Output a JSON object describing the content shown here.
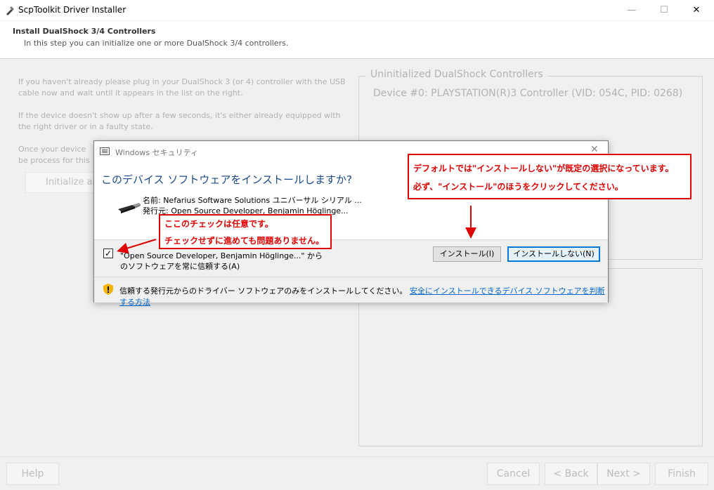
{
  "window": {
    "title": "ScpToolkit Driver Installer",
    "min_glyph": "—",
    "max_glyph": "☐",
    "close_glyph": "✕"
  },
  "header": {
    "title": "Install DualShock 3/4 Controllers",
    "description": "In this step you can initialize one or more DualShock 3/4 controllers."
  },
  "instructions": {
    "p1": "If you haven't already please plug in your DualShock 3 (or 4) controller with the USB cable now and wait until it appears in the list on the right.",
    "p2": "If the device doesn't show up after a few seconds, it's either already equipped with the right driver or in a faulty state.",
    "p3": "Once your device be process for this parti",
    "init_button": "Initialize al"
  },
  "controllers": {
    "group_title": "Uninitialized DualShock Controllers",
    "device": "Device #0: PLAYSTATION(R)3 Controller (VID: 054C, PID: 0268)"
  },
  "footer": {
    "help": "Help",
    "cancel": "Cancel",
    "back": "< Back",
    "next": "Next >",
    "finish": "Finish"
  },
  "dialog": {
    "title": "Windows セキュリティ",
    "close_glyph": "✕",
    "question": "このデバイス ソフトウェアをインストールしますか?",
    "name_line": "名前: Nefarius Software Solutions ユニバーサル シリアル ...",
    "publisher_line": "発行元: Open Source Developer, Benjamin Höglinge...",
    "checkbox_checked": true,
    "checkbox_glyph": "✓",
    "trust_line1": "\"Open Source Developer, Benjamin Höglinge...\" から",
    "trust_line2": "のソフトウェアを常に信頼する(A)",
    "install_button": "インストール(I)",
    "dont_install_button": "インストールしない(N)",
    "warning_text": "信頼する発行元からのドライバー ソフトウェアのみをインストールしてください。",
    "warning_link": "安全にインストールできるデバイス ソフトウェアを判断する方法"
  },
  "annotations": {
    "note1_line1": "デフォルトでは\"インストールしない\"が既定の選択になっています。",
    "note1_line2": "必ず、\"インストール\"のほうをクリックしてください。",
    "note2_line1": "ここのチェックは任意です。",
    "note2_line2": "チェックせずに進めても問題ありません。",
    "color": "#e00000"
  }
}
